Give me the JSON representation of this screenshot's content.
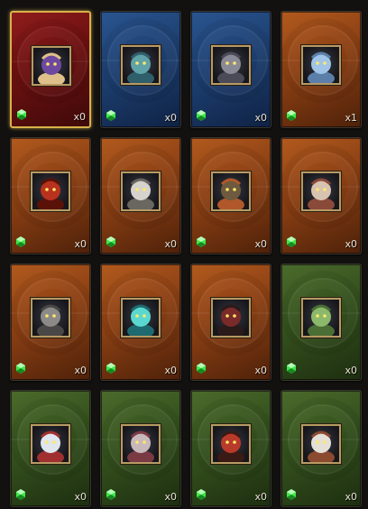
{
  "cards": [
    {
      "name": "card-dark-mage",
      "theme": "red",
      "selected": true,
      "icon": "dark-mage-portrait-icon",
      "hue": "#6d4aa0",
      "accent": "#e0c08a",
      "count": "x0"
    },
    {
      "name": "card-ice-goblin",
      "theme": "blue",
      "selected": false,
      "icon": "ice-goblin-portrait-icon",
      "hue": "#5fa2a8",
      "accent": "#2f5f6a",
      "count": "x0"
    },
    {
      "name": "card-stone-golem",
      "theme": "blue",
      "selected": false,
      "icon": "stone-golem-portrait-icon",
      "hue": "#8a8a96",
      "accent": "#4b4b58",
      "count": "x0"
    },
    {
      "name": "card-ice-spirit",
      "theme": "orange",
      "selected": false,
      "icon": "ice-spirit-portrait-icon",
      "hue": "#9fc4e8",
      "accent": "#5b7fa8",
      "count": "x1"
    },
    {
      "name": "card-fire-imp",
      "theme": "orange",
      "selected": false,
      "icon": "fire-imp-portrait-icon",
      "hue": "#b8321e",
      "accent": "#5a1208",
      "count": "x0"
    },
    {
      "name": "card-white-haired-warrior",
      "theme": "orange",
      "selected": false,
      "icon": "white-haired-warrior-portrait-icon",
      "hue": "#d6d2cc",
      "accent": "#6a6660",
      "count": "x0"
    },
    {
      "name": "card-horned-beast",
      "theme": "orange",
      "selected": false,
      "icon": "horned-beast-portrait-icon",
      "hue": "#6e5a3e",
      "accent": "#b0582a",
      "count": "x0"
    },
    {
      "name": "card-bone-crawler",
      "theme": "orange",
      "selected": false,
      "icon": "bone-crawler-portrait-icon",
      "hue": "#d8c2b0",
      "accent": "#8a4a3a",
      "count": "x0"
    },
    {
      "name": "card-armored-pig",
      "theme": "orange",
      "selected": false,
      "icon": "armored-pig-portrait-icon",
      "hue": "#8c8a88",
      "accent": "#4a4846",
      "count": "x0"
    },
    {
      "name": "card-crystal-orb",
      "theme": "orange",
      "selected": false,
      "icon": "crystal-orb-portrait-icon",
      "hue": "#5ad8d0",
      "accent": "#1e6a70",
      "count": "x0"
    },
    {
      "name": "card-dark-knight",
      "theme": "orange",
      "selected": false,
      "icon": "dark-knight-portrait-icon",
      "hue": "#7a2a28",
      "accent": "#2a1a1a",
      "count": "x0"
    },
    {
      "name": "card-frog",
      "theme": "green",
      "selected": false,
      "icon": "frog-portrait-icon",
      "hue": "#8bb86a",
      "accent": "#4a6e34",
      "count": "x0"
    },
    {
      "name": "card-white-ghost",
      "theme": "green",
      "selected": false,
      "icon": "white-ghost-portrait-icon",
      "hue": "#dfe6ee",
      "accent": "#a03030",
      "count": "x0"
    },
    {
      "name": "card-grey-sage",
      "theme": "green",
      "selected": false,
      "icon": "grey-sage-portrait-icon",
      "hue": "#c8b8bc",
      "accent": "#7a3a44",
      "count": "x0"
    },
    {
      "name": "card-red-bandit",
      "theme": "green",
      "selected": false,
      "icon": "red-bandit-portrait-icon",
      "hue": "#b83a2a",
      "accent": "#3a1a14",
      "count": "x0"
    },
    {
      "name": "card-white-bearded-elder",
      "theme": "green",
      "selected": false,
      "icon": "white-bearded-elder-portrait-icon",
      "hue": "#e4e0d8",
      "accent": "#8a4a30",
      "count": "x0"
    }
  ],
  "gem_icon": "green-gem-icon",
  "colors": {
    "gem": "#3ee84a",
    "gem_dark": "#178a22",
    "selected_border": "#d8b24a"
  }
}
